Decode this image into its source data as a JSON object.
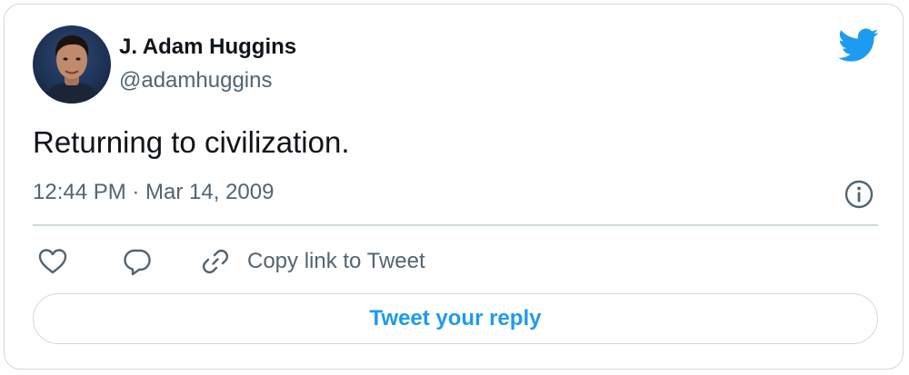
{
  "author": {
    "name": "J. Adam Huggins",
    "handle": "@adamhuggins"
  },
  "tweet": {
    "text": "Returning to civilization.",
    "timestamp": "12:44 PM · Mar 14, 2009"
  },
  "actions": {
    "copy_link_label": "Copy link to Tweet",
    "reply_button_label": "Tweet your reply"
  },
  "icons": {
    "brand": "twitter-bird-icon",
    "info": "info-icon",
    "like": "heart-icon",
    "reply": "speech-bubble-icon",
    "link": "link-icon"
  },
  "colors": {
    "accent": "#1d9bf0",
    "text_primary": "#0f1419",
    "text_secondary": "#536471",
    "border": "#cfd9de"
  }
}
